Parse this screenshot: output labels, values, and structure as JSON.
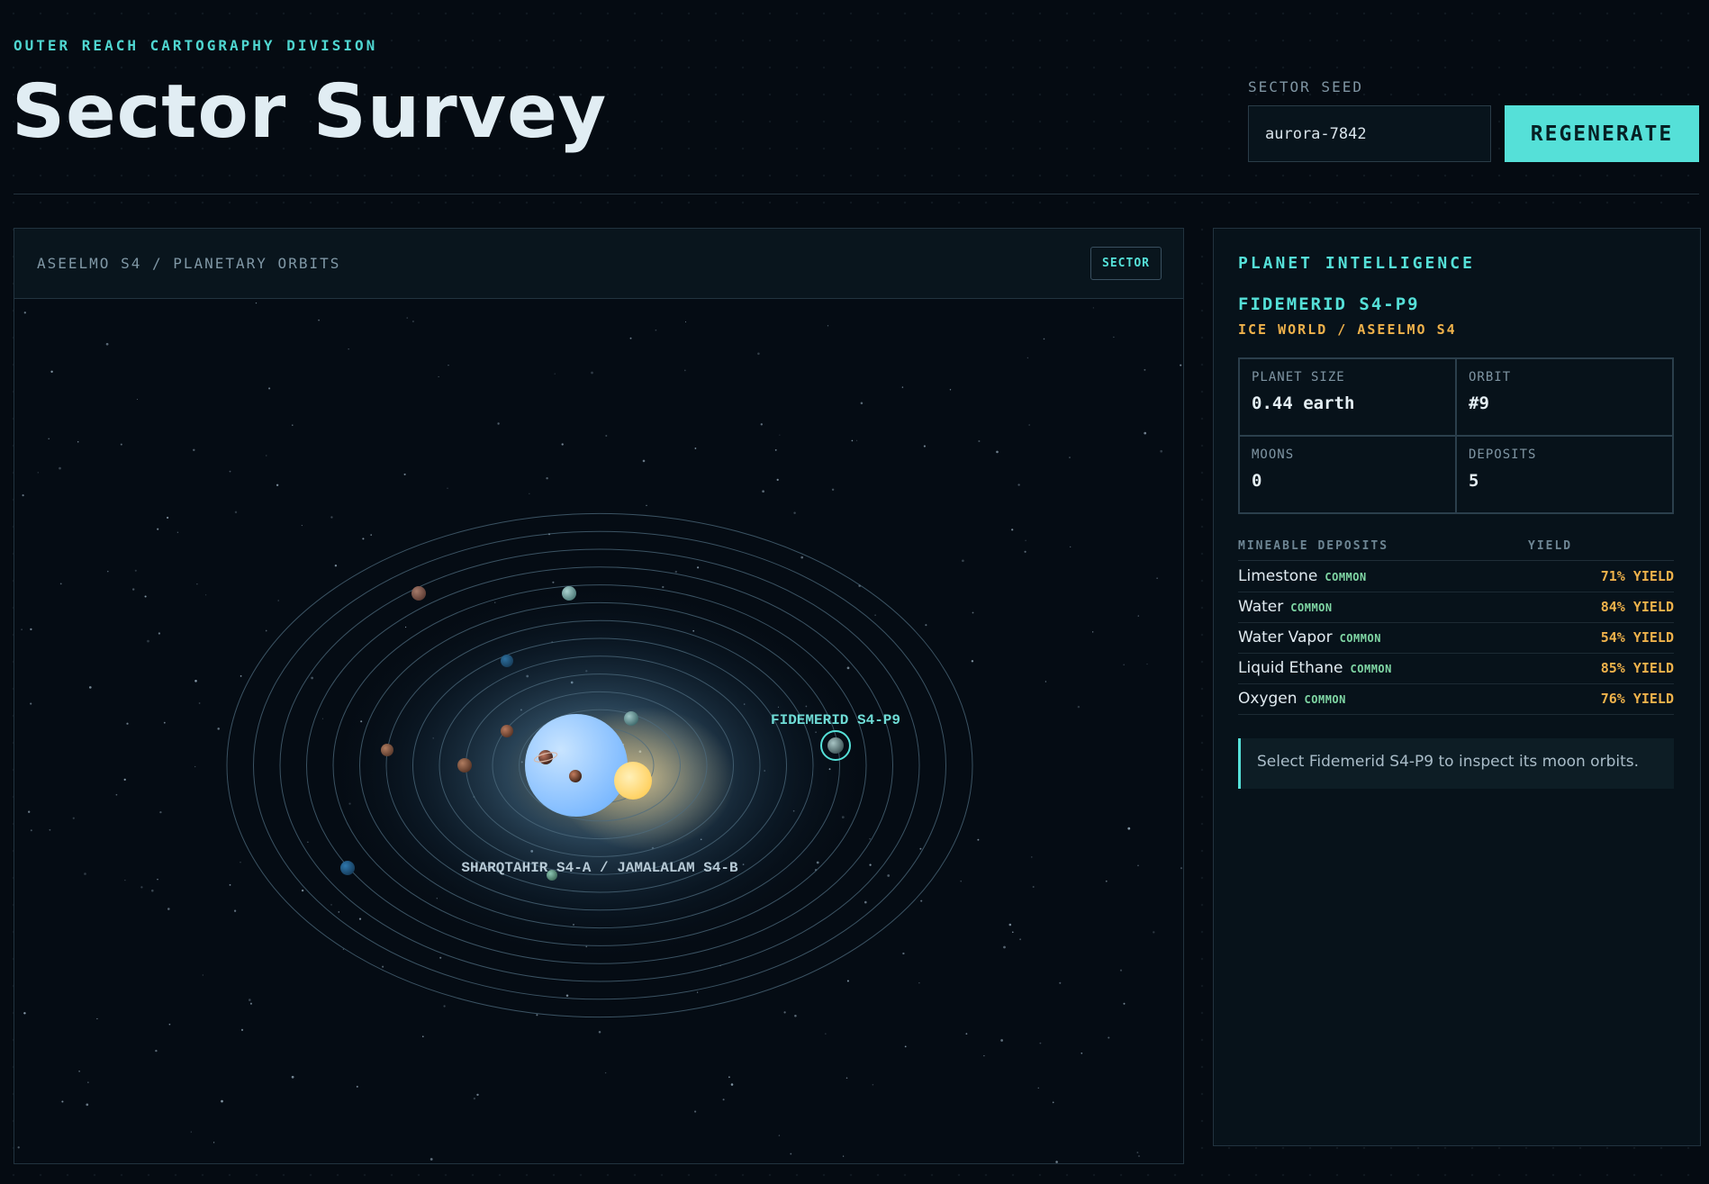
{
  "header": {
    "eyebrow": "OUTER REACH CARTOGRAPHY DIVISION",
    "title": "Sector Survey"
  },
  "seed": {
    "label": "SECTOR SEED",
    "value": "aurora-7842",
    "button_label": "REGENERATE"
  },
  "map": {
    "title": "ASEELMO S4 / PLANETARY ORBITS",
    "sector_button": "SECTOR",
    "selected_label": "FIDEMERID S4-P9",
    "star_label": "SHARQTAHIR S4-A / JAMALALAM S4-B"
  },
  "intel": {
    "heading": "PLANET INTELLIGENCE",
    "planet_name": "FIDEMERID S4-P9",
    "planet_type": "ICE WORLD / ASEELMO S4",
    "stats": {
      "size_label": "PLANET SIZE",
      "size_value": "0.44 earth",
      "orbit_label": "ORBIT",
      "orbit_value": "#9",
      "moons_label": "MOONS",
      "moons_value": "0",
      "deposits_label": "DEPOSITS",
      "deposits_value": "5"
    },
    "deposits_header": "MINEABLE DEPOSITS",
    "yield_header": "YIELD",
    "deposits": [
      {
        "name": "Limestone",
        "rarity": "COMMON",
        "yield": "71% YIELD"
      },
      {
        "name": "Water",
        "rarity": "COMMON",
        "yield": "84% YIELD"
      },
      {
        "name": "Water Vapor",
        "rarity": "COMMON",
        "yield": "54% YIELD"
      },
      {
        "name": "Liquid Ethane",
        "rarity": "COMMON",
        "yield": "85% YIELD"
      },
      {
        "name": "Oxygen",
        "rarity": "COMMON",
        "yield": "76% YIELD"
      }
    ],
    "hint": "Select Fidemerid S4-P9 to inspect its moon orbits."
  },
  "colors": {
    "accent": "#55e0d8",
    "warning": "#efb24b",
    "rarity_common": "#7fd6a4",
    "background": "#050b12",
    "star_primary": "#8cc8ff",
    "star_secondary": "#ffd97a"
  },
  "icons": {
    "planets": "planet-icon",
    "primary_star": "star-icon",
    "secondary_star": "star-icon"
  }
}
